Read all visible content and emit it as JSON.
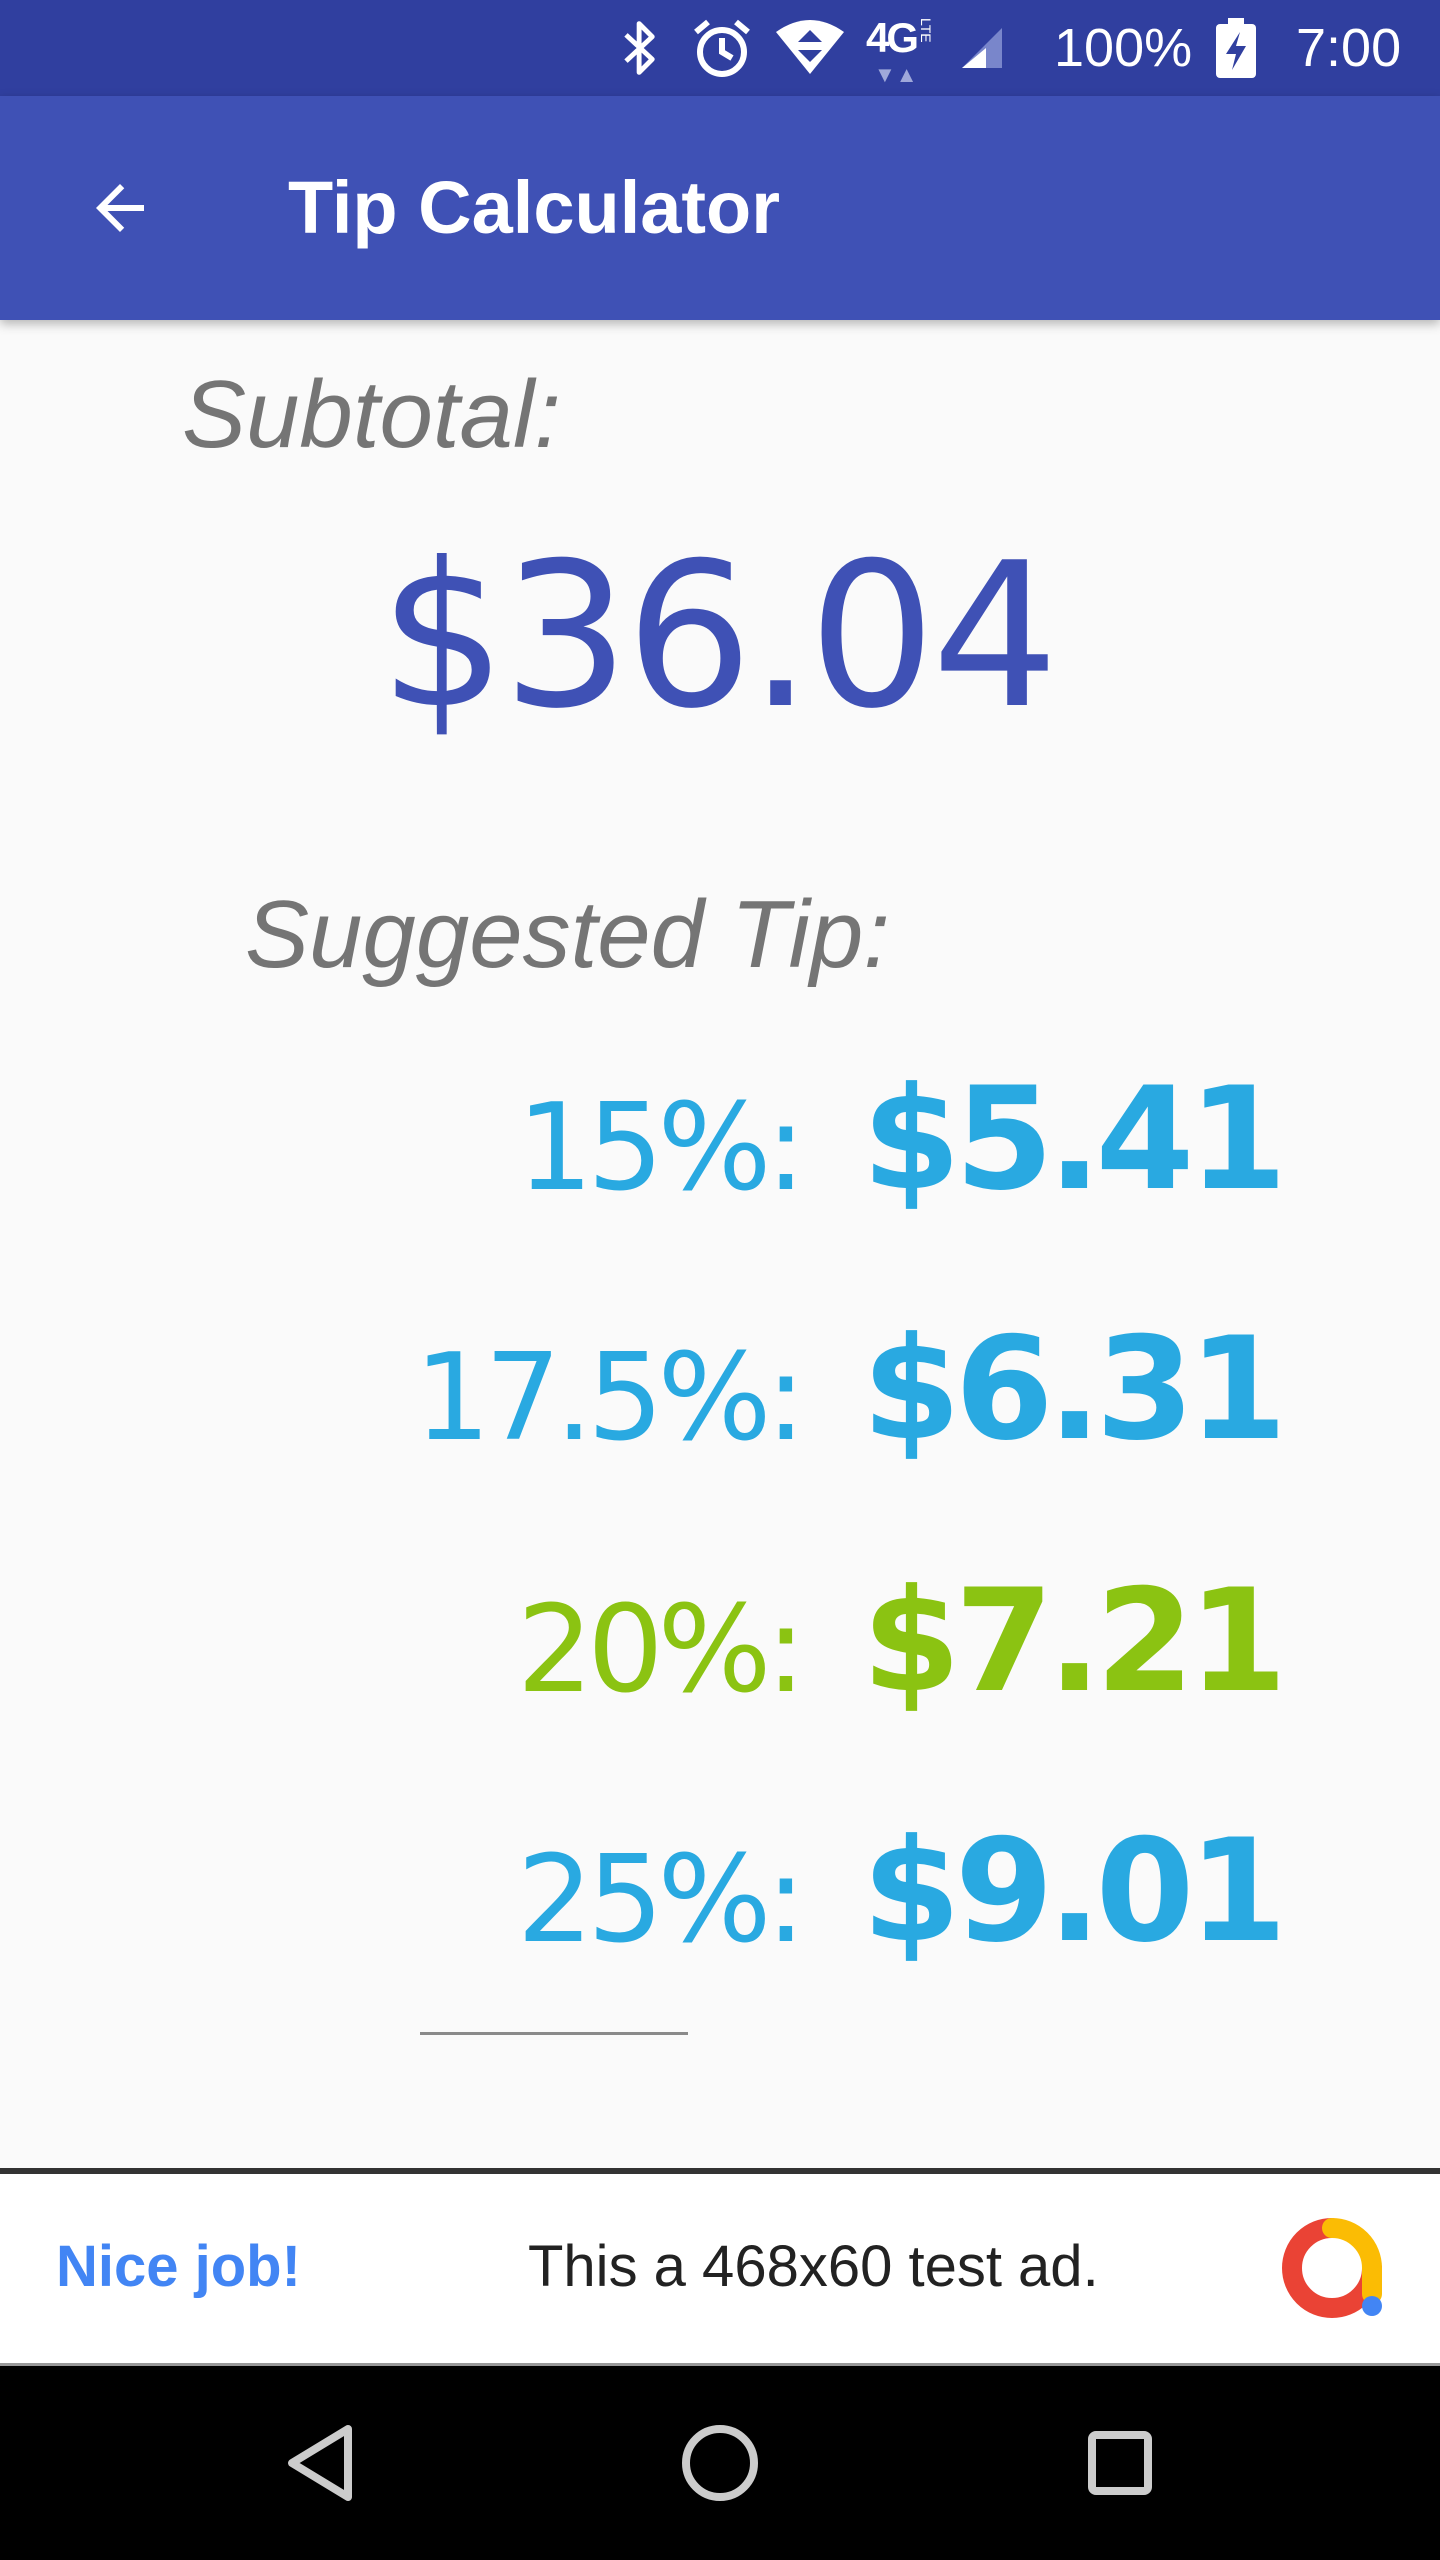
{
  "status_bar": {
    "battery": "100%",
    "time": "7:00",
    "icons": [
      "bluetooth-icon",
      "alarm-icon",
      "wifi-icon",
      "4g-lte-icon",
      "signal-icon",
      "battery-charging-icon"
    ],
    "network": "4G"
  },
  "app_bar": {
    "title": "Tip Calculator",
    "back_icon": "arrow-back-icon",
    "background": "#3f51b5",
    "status_background": "#303f9f"
  },
  "subtotal": {
    "label": "Subtotal:",
    "value": "$36.04",
    "color": "#3f51b5"
  },
  "suggested_tip": {
    "label": "Suggested Tip:",
    "rows": [
      {
        "percent": "15%:",
        "amount": "$5.41",
        "color": "#29a9e1"
      },
      {
        "percent": "17.5%:",
        "amount": "$6.31",
        "color": "#29a9e1"
      },
      {
        "percent": "20%:",
        "amount": "$7.21",
        "color": "#8bc312"
      },
      {
        "percent": "25%:",
        "amount": "$9.01",
        "color": "#29a9e1"
      }
    ]
  },
  "ad": {
    "headline": "Nice job!",
    "text": "This a 468x60 test ad.",
    "logo_icon": "ad-logo-icon"
  },
  "nav_bar": {
    "buttons": [
      "back-triangle-icon",
      "home-circle-icon",
      "recents-square-icon"
    ]
  }
}
